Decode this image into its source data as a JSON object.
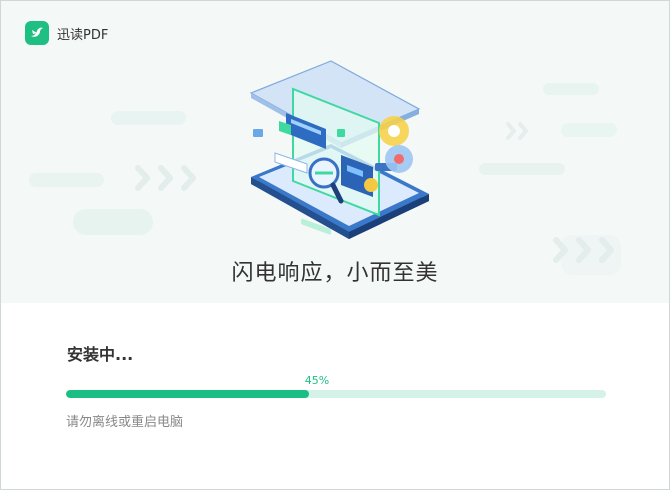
{
  "app": {
    "name": "迅读PDF",
    "logo_icon": "bird-logo-icon"
  },
  "hero": {
    "slogan": "闪电响应，小而至美",
    "illustration_icon": "pdf-reader-illustration"
  },
  "install": {
    "status": "安装中...",
    "progress_fraction": 0.45,
    "progress_label": "45%",
    "hint": "请勿离线或重启电脑"
  },
  "colors": {
    "accent": "#1bbe84",
    "track": "#d4f2e7",
    "hero_bg": "#f4f8f7"
  }
}
